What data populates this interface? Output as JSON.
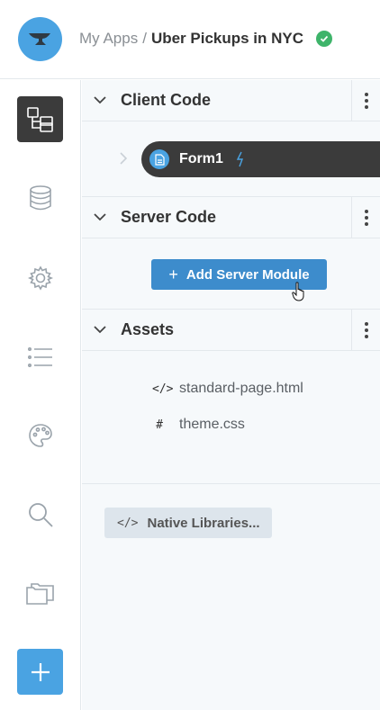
{
  "header": {
    "breadcrumb_parent": "My Apps",
    "breadcrumb_separator": "/",
    "app_name": "Uber Pickups in NYC",
    "status_color": "#3eb46a"
  },
  "rail": {
    "items": [
      {
        "icon": "app-tree-icon",
        "active": true
      },
      {
        "icon": "database-icon",
        "active": false
      },
      {
        "icon": "gear-icon",
        "active": false
      },
      {
        "icon": "list-icon",
        "active": false
      },
      {
        "icon": "palette-icon",
        "active": false
      },
      {
        "icon": "search-icon",
        "active": false
      },
      {
        "icon": "folders-icon",
        "active": false
      }
    ],
    "add_icon": "plus-icon"
  },
  "sections": {
    "client": {
      "title": "Client Code",
      "forms": [
        {
          "label": "Form1",
          "startup": true
        }
      ]
    },
    "server": {
      "title": "Server Code",
      "add_button_label": "Add Server Module"
    },
    "assets": {
      "title": "Assets",
      "files": [
        {
          "icon": "</>",
          "label": "standard-page.html"
        },
        {
          "icon": "#",
          "label": "theme.css"
        }
      ]
    }
  },
  "native_libraries": {
    "icon": "</>",
    "label": "Native Libraries..."
  },
  "colors": {
    "accent": "#4aa3e2",
    "button": "#3d8ccc",
    "dark": "#3b3b3b",
    "panel_bg": "#f6f9fb"
  }
}
